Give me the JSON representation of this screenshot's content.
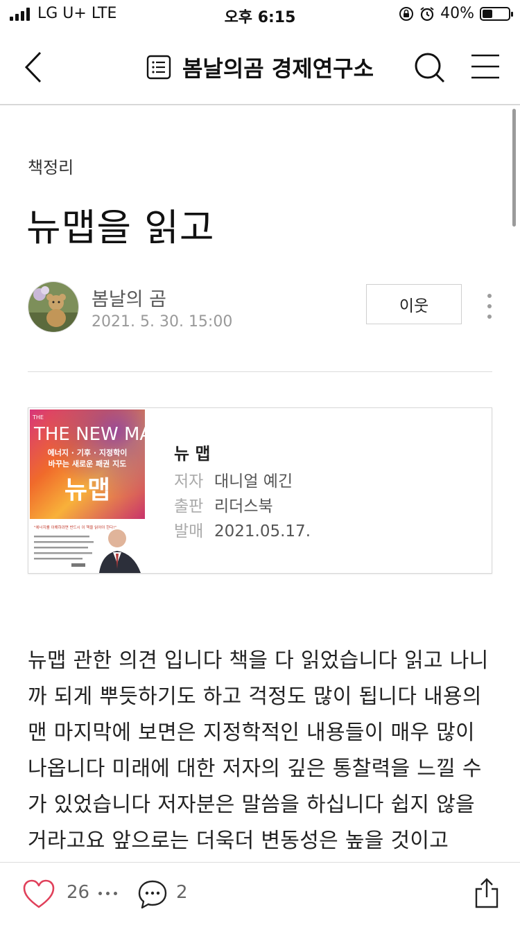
{
  "status_bar": {
    "carrier": "LG U+  LTE",
    "time": "오후 6:15",
    "battery_text": "40%",
    "battery_level": 0.4
  },
  "nav": {
    "title": "봄날의곰 경제연구소",
    "icons": [
      "back-chevron-icon",
      "list-icon",
      "search-icon",
      "menu-icon"
    ]
  },
  "post": {
    "category": "책정리",
    "title": "뉴맵을 읽고",
    "author": "봄날의 곰",
    "date": "2021. 5. 30. 15:00",
    "follow_label": "이웃"
  },
  "book": {
    "name": "뉴 맵",
    "author_label": "저자",
    "author": "대니얼 예긴",
    "publisher_label": "출판",
    "publisher": "리더스북",
    "release_label": "발매",
    "release": "2021.05.17.",
    "cover": {
      "top_title": "THE NEW MAP",
      "subtitle_line1": "에너지 · 기후 · 지정학이",
      "subtitle_line2": "바꾸는 새로운 패권 지도",
      "main_title": "뉴맵",
      "quote": "\"에너지를 이해하려면 반드시 이 책을 읽어야 한다!\""
    }
  },
  "body_text": "뉴맵 관한 의견 입니다 책을 다 읽었습니다 읽고 나니까 되게 뿌듯하기도 하고 걱정도 많이 됩니다 내용의 맨 마지막에 보면은 지정학적인 내용들이 매우 많이 나옵니다 미래에 대한 저자의 깊은 통찰력을 느낄 수가 있었습니다 저자분은 말씀을 하십니다 쉽지 않을 거라고요 앞으로는 더욱더 변동성은 높을 것이고",
  "bottom_bar": {
    "like_count": "26",
    "comment_count": "2"
  },
  "colors": {
    "like_heart": "#e0405a",
    "divider": "#dcdcdc",
    "muted_text": "#999999"
  }
}
